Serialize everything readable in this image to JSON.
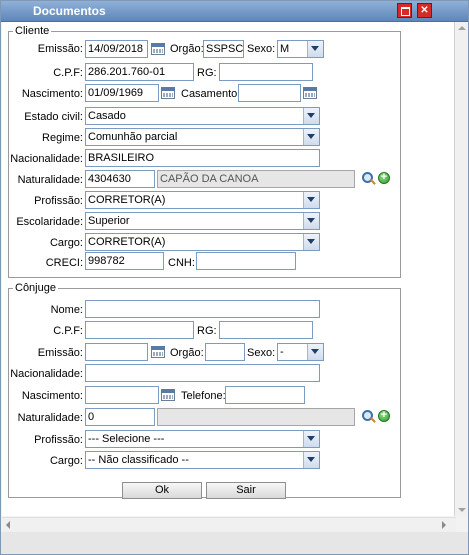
{
  "window": {
    "title": "Documentos"
  },
  "cliente": {
    "legend": "Cliente",
    "emissao_label": "Emissão:",
    "emissao_value": "14/09/2018",
    "orgao_label": "Orgão:",
    "orgao_value": "SSPSC",
    "sexo_label": "Sexo:",
    "sexo_value": "M",
    "cpf_label": "C.P.F:",
    "cpf_value": "286.201.760-01",
    "rg_label": "RG:",
    "rg_value": "",
    "nascimento_label": "Nascimento:",
    "nascimento_value": "01/09/1969",
    "casamento_label": "Casamento:",
    "casamento_value": "",
    "estado_civil_label": "Estado civil:",
    "estado_civil_value": "Casado",
    "regime_label": "Regime:",
    "regime_value": "Comunhão parcial",
    "nacionalidade_label": "Nacionalidade:",
    "nacionalidade_value": "BRASILEIRO",
    "naturalidade_label": "Naturalidade:",
    "naturalidade_code": "4304630",
    "naturalidade_city": "CAPÃO DA CANOA",
    "profissao_label": "Profissão:",
    "profissao_value": "CORRETOR(A)",
    "escolaridade_label": "Escolaridade:",
    "escolaridade_value": "Superior",
    "cargo_label": "Cargo:",
    "cargo_value": "CORRETOR(A)",
    "creci_label": "CRECI:",
    "creci_value": "998782",
    "cnh_label": "CNH:",
    "cnh_value": ""
  },
  "conjuge": {
    "legend": "Cônjuge",
    "nome_label": "Nome:",
    "nome_value": "",
    "cpf_label": "C.P.F:",
    "cpf_value": "",
    "rg_label": "RG:",
    "rg_value": "",
    "emissao_label": "Emissão:",
    "emissao_value": "",
    "orgao_label": "Orgão:",
    "orgao_value": "",
    "sexo_label": "Sexo:",
    "sexo_value": "-",
    "nacionalidade_label": "Nacionalidade:",
    "nacionalidade_value": "",
    "nascimento_label": "Nascimento:",
    "nascimento_value": "",
    "telefone_label": "Telefone:",
    "telefone_value": "",
    "naturalidade_label": "Naturalidade:",
    "naturalidade_code": "0",
    "naturalidade_city": "",
    "profissao_label": "Profissão:",
    "profissao_value": "--- Selecione ---",
    "cargo_label": "Cargo:",
    "cargo_value": "-- Não classificado --"
  },
  "actions": {
    "ok_label": "Ok",
    "sair_label": "Sair"
  },
  "icons": {
    "calendar": "calendar-icon",
    "search": "search-icon",
    "add": "add-icon",
    "maximize": "maximize-icon",
    "close": "close-icon"
  },
  "colors": {
    "titlebar": "#6a8fc0",
    "close_button": "#d42a2a",
    "input_border": "#7a9cc2"
  }
}
